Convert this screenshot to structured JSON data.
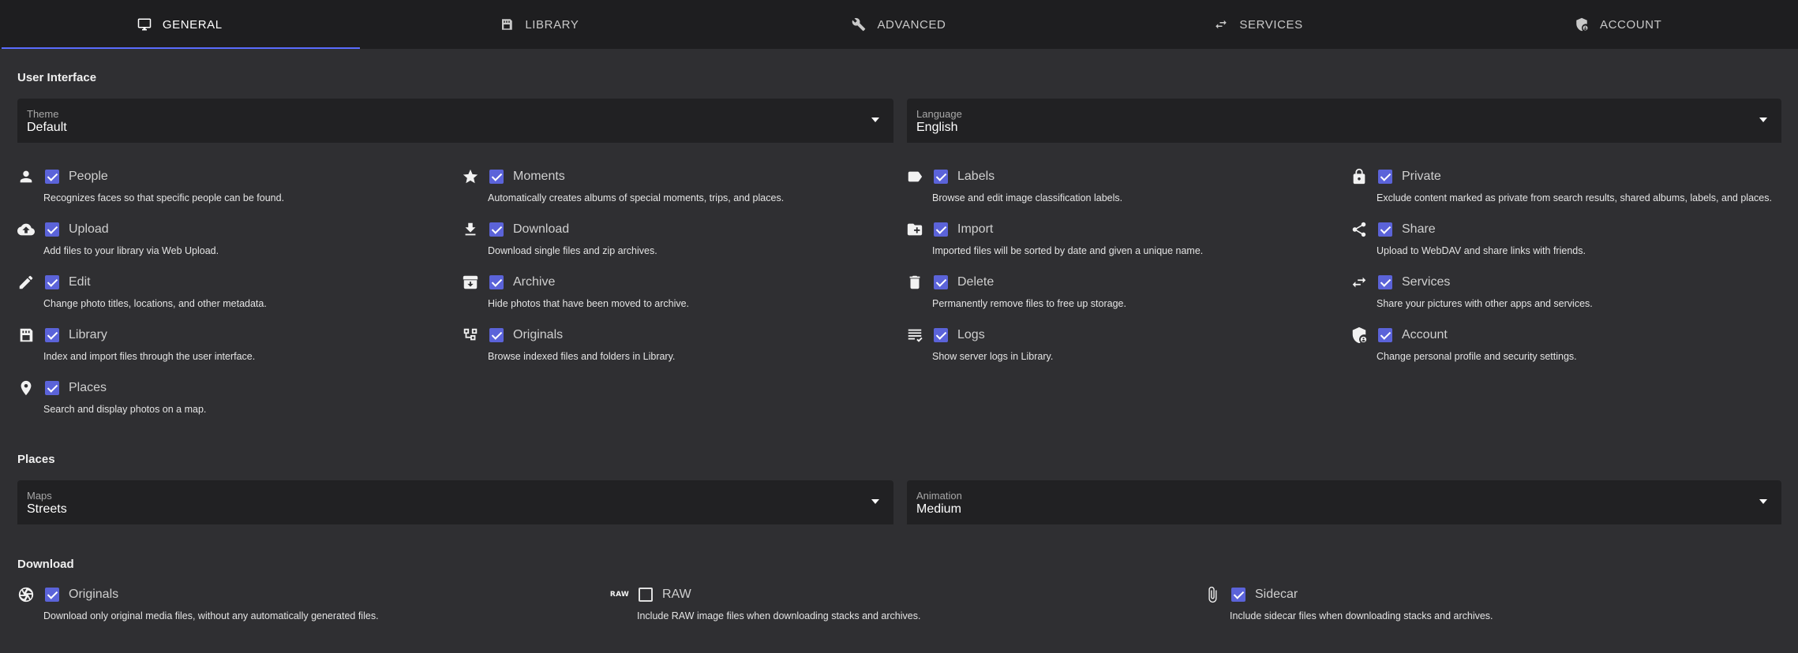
{
  "tabs": [
    {
      "label": "General",
      "icon": "monitor-icon",
      "active": true
    },
    {
      "label": "Library",
      "icon": "library-icon",
      "active": false
    },
    {
      "label": "Advanced",
      "icon": "wrench-icon",
      "active": false
    },
    {
      "label": "Services",
      "icon": "swap-icon",
      "active": false
    },
    {
      "label": "Account",
      "icon": "account-shield-icon",
      "active": false
    }
  ],
  "user_interface": {
    "title": "User Interface",
    "theme": {
      "label": "Theme",
      "value": "Default"
    },
    "language": {
      "label": "Language",
      "value": "English"
    },
    "options": [
      {
        "name": "People",
        "icon": "person-icon",
        "checked": true,
        "desc": "Recognizes faces so that specific people can be found."
      },
      {
        "name": "Moments",
        "icon": "star-icon",
        "checked": true,
        "desc": "Automatically creates albums of special moments, trips, and places."
      },
      {
        "name": "Labels",
        "icon": "label-icon",
        "checked": true,
        "desc": "Browse and edit image classification labels."
      },
      {
        "name": "Private",
        "icon": "lock-icon",
        "checked": true,
        "desc": "Exclude content marked as private from search results, shared albums, labels, and places."
      },
      {
        "name": "Upload",
        "icon": "cloud-upload-icon",
        "checked": true,
        "desc": "Add files to your library via Web Upload."
      },
      {
        "name": "Download",
        "icon": "download-icon",
        "checked": true,
        "desc": "Download single files and zip archives."
      },
      {
        "name": "Import",
        "icon": "folder-plus-icon",
        "checked": true,
        "desc": "Imported files will be sorted by date and given a unique name."
      },
      {
        "name": "Share",
        "icon": "share-icon",
        "checked": true,
        "desc": "Upload to WebDAV and share links with friends."
      },
      {
        "name": "Edit",
        "icon": "pencil-icon",
        "checked": true,
        "desc": "Change photo titles, locations, and other metadata."
      },
      {
        "name": "Archive",
        "icon": "archive-icon",
        "checked": true,
        "desc": "Hide photos that have been moved to archive."
      },
      {
        "name": "Delete",
        "icon": "trash-icon",
        "checked": true,
        "desc": "Permanently remove files to free up storage."
      },
      {
        "name": "Services",
        "icon": "swap-icon",
        "checked": true,
        "desc": "Share your pictures with other apps and services."
      },
      {
        "name": "Library",
        "icon": "library-icon",
        "checked": true,
        "desc": "Index and import files through the user interface."
      },
      {
        "name": "Originals",
        "icon": "file-tree-icon",
        "checked": true,
        "desc": "Browse indexed files and folders in Library."
      },
      {
        "name": "Logs",
        "icon": "logs-icon",
        "checked": true,
        "desc": "Show server logs in Library."
      },
      {
        "name": "Account",
        "icon": "account-shield-icon",
        "checked": true,
        "desc": "Change personal profile and security settings."
      },
      {
        "name": "Places",
        "icon": "map-pin-icon",
        "checked": true,
        "desc": "Search and display photos on a map."
      }
    ]
  },
  "places": {
    "title": "Places",
    "maps": {
      "label": "Maps",
      "value": "Streets"
    },
    "animation": {
      "label": "Animation",
      "value": "Medium"
    }
  },
  "download": {
    "title": "Download",
    "options": [
      {
        "name": "Originals",
        "icon": "aperture-icon",
        "checked": true,
        "desc": "Download only original media files, without any automatically generated files."
      },
      {
        "name": "RAW",
        "icon": "raw-icon",
        "icon_text": "RAW",
        "checked": false,
        "desc": "Include RAW image files when downloading stacks and archives."
      },
      {
        "name": "Sidecar",
        "icon": "paperclip-icon",
        "checked": true,
        "desc": "Include sidecar files when downloading stacks and archives."
      }
    ]
  },
  "colors": {
    "accent": "#5b63d9",
    "tab_indicator": "#5a6cff",
    "background": "#2f2f32",
    "field": "#212123"
  }
}
